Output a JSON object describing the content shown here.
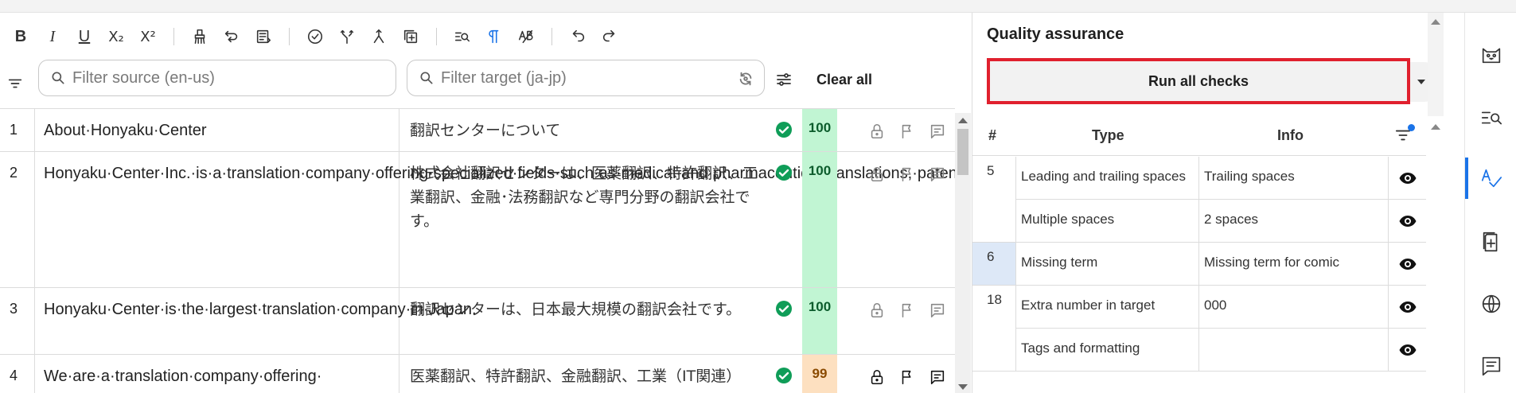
{
  "toolbar": {
    "bold": "B",
    "italic": "I",
    "underline": "U",
    "subscript": "X₂",
    "superscript": "X²"
  },
  "filters": {
    "source_placeholder": "Filter source (en-us)",
    "target_placeholder": "Filter target (ja-jp)",
    "clear_all": "Clear all"
  },
  "segments": [
    {
      "num": "1",
      "source": "About·Honyaku·Center",
      "target": "翻訳センターについて",
      "score": "100"
    },
    {
      "num": "2",
      "source": "Honyaku·Center·Inc.·is·a·translation·company·offering·specialized·fields·such·as·medical·and·pharmaceutical·translations,·patent·translations,·industrial·translations,·and·financial·and·legal·translations.",
      "target": "株式会社翻訳センターは、医薬翻訳、特許翻訳、工業翻訳、金融･法務翻訳など専門分野の翻訳会社です。",
      "score": "100"
    },
    {
      "num": "3",
      "source": "Honyaku·Center·is·the·largest·translation·company·in·Japan.",
      "target": "翻訳センターは、日本最大規模の翻訳会社です。",
      "score": "100"
    },
    {
      "num": "4",
      "source": "We·are·a·translation·company·offering·",
      "target": "医薬翻訳、特許翻訳、金融翻訳、工業（IT関連）",
      "score": "99"
    }
  ],
  "qa": {
    "title": "Quality assurance",
    "run_all": "Run all checks",
    "headers": {
      "num": "#",
      "type": "Type",
      "info": "Info"
    },
    "rows": [
      {
        "num": "5",
        "type": "Leading and trailing spaces",
        "info": "Trailing spaces"
      },
      {
        "num": "",
        "type": "Multiple spaces",
        "info": "2 spaces"
      },
      {
        "num": "6",
        "type": "Missing term",
        "info": "Missing term for comic"
      },
      {
        "num": "18",
        "type": "Extra number in target",
        "info": "000"
      },
      {
        "num": "",
        "type": "Tags and formatting",
        "info": ""
      }
    ]
  },
  "colors": {
    "accent": "#1a73e8",
    "highlight_border": "#e0202e",
    "score_full": "#c1f5d3",
    "score_fuzzy": "#fde0c0",
    "confirmed": "#0f9d58"
  },
  "icons": [
    "cat-icon",
    "search-list-icon",
    "spellcheck-icon",
    "add-document-icon",
    "globe-icon",
    "comment-icon"
  ]
}
